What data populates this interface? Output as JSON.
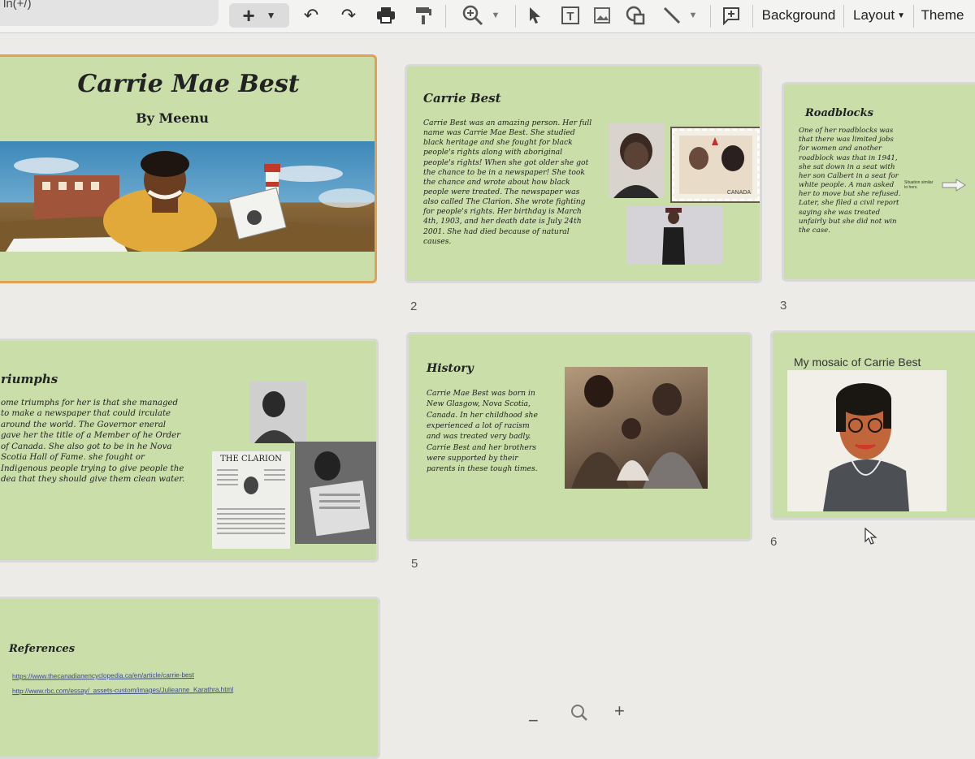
{
  "toolbar": {
    "menu_fragment": "ln(+/)",
    "background": "Background",
    "layout": "Layout",
    "theme": "Theme"
  },
  "slides": {
    "s1": {
      "title": "Carrie Mae Best",
      "subtitle": "By Meenu"
    },
    "s2": {
      "number": "2",
      "title": "Carrie Best",
      "body": "Carrie Best was an amazing person. Her full name was Carrie Mae Best. She studied black heritage and she fought for black people's rights along with aboriginal people's rights! When she got older she got the chance to be in a newspaper! She took the chance and wrote about how black people were treated. The newspaper was also called The Clarion. She wrote fighting for people's rights. Her birthday is March 4th, 1903, and her death date is July 24th 2001. She had died because of natural causes.",
      "stamp_text": "CANADA"
    },
    "s3": {
      "number": "3",
      "title": "Roadblocks",
      "body": "One of her roadblocks was that there was limited jobs for women and another roadblock was that in 1941, she sat down in a seat with her son Calbert in a seat for white people. A man asked her to move but she refused. Later, she filed a civil report saying she was treated unfairly but she did not win the case.",
      "side_note": "Situation similar to hers."
    },
    "s4": {
      "title": "riumphs",
      "body": "ome triumphs for her is that she managed to make a newspaper that could irculate around the world. The Governor eneral gave her the title of a Member of he Order of Canada. She also got to be in he Nova Scotia Hall of Fame. she fought or Indigenous people trying to give people the dea that they should give them clean water.",
      "clarion_label": "THE CLARION"
    },
    "s5": {
      "number": "5",
      "title": "History",
      "body": "Carrie Mae Best was born in New Glasgow, Nova Scotia, Canada. In her childhood she experienced a lot of racism and was treated very badly. Carrie Best and her brothers were supported by their parents in these tough times."
    },
    "s6": {
      "number": "6",
      "title": "My mosaic of Carrie Best"
    },
    "s7": {
      "title": "References",
      "links": [
        "https://www.thecanadianencyclopedia.ca/en/article/carrie-best",
        "http://www.rbc.com/essay/_assets-custom/images/Julieanne_Karathra.html"
      ]
    }
  },
  "zoom": {
    "minus": "−",
    "plus": "+"
  },
  "colors": {
    "slide_bg": "#c9dea9",
    "selected_border": "#e4a052"
  }
}
